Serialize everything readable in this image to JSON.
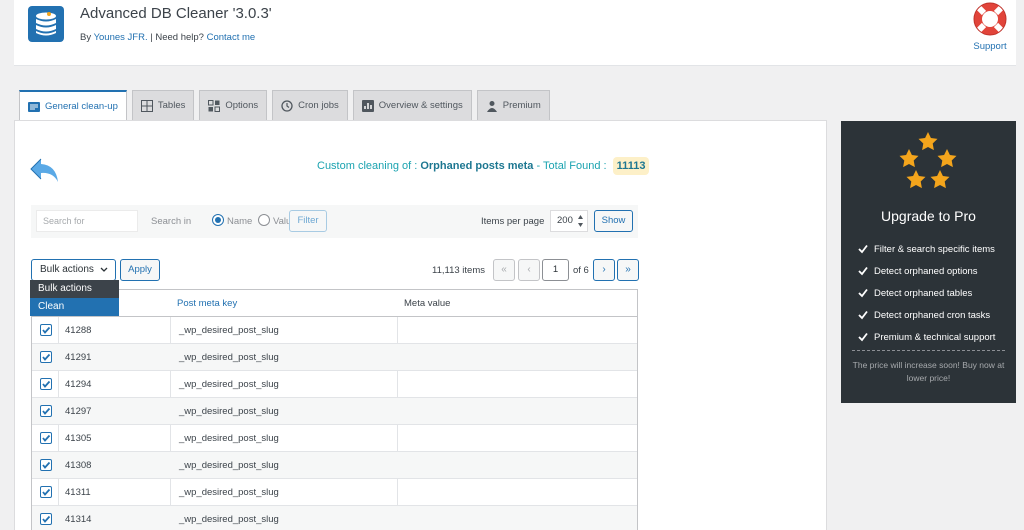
{
  "header": {
    "title": "Advanced DB Cleaner '3.0.3'",
    "by_prefix": "By",
    "author": "Younes JFR.",
    "separator": "|",
    "need_help": "Need help?",
    "contact": "Contact me",
    "support_label": "Support"
  },
  "tabs": [
    {
      "label": "General clean-up",
      "icon": "list-icon",
      "active": true
    },
    {
      "label": "Tables",
      "icon": "grid-icon",
      "active": false
    },
    {
      "label": "Options",
      "icon": "options-icon",
      "active": false
    },
    {
      "label": "Cron jobs",
      "icon": "history-icon",
      "active": false
    },
    {
      "label": "Overview & settings",
      "icon": "chart-icon",
      "active": false
    },
    {
      "label": "Premium",
      "icon": "person-icon",
      "active": false
    }
  ],
  "heading": {
    "prefix": "Custom cleaning of :",
    "target": "Orphaned posts meta",
    "dash": "-",
    "total_label": "Total Found :",
    "total": "11113"
  },
  "filter": {
    "search_placeholder": "Search for",
    "search_in_label": "Search in",
    "option_name": "Name",
    "option_value": "Value",
    "selected": "Name",
    "filter_button": "Filter",
    "items_per_page_label": "Items per page",
    "items_per_page": "200",
    "show_button": "Show"
  },
  "bulk": {
    "selected": "Bulk actions",
    "options": [
      "Bulk actions",
      "Clean"
    ],
    "highlighted": "Clean",
    "apply_button": "Apply"
  },
  "pagination": {
    "items_count": "11,113 items",
    "first": "«",
    "prev": "‹",
    "current_page": "1",
    "of_total": "of 6",
    "next": "›",
    "last": "»"
  },
  "table": {
    "columns": [
      "Post meta key",
      "Meta value"
    ],
    "rows": [
      {
        "id": "41288",
        "key": "_wp_desired_post_slug",
        "value": "",
        "checked": true
      },
      {
        "id": "41291",
        "key": "_wp_desired_post_slug",
        "value": "",
        "checked": true
      },
      {
        "id": "41294",
        "key": "_wp_desired_post_slug",
        "value": "",
        "checked": true
      },
      {
        "id": "41297",
        "key": "_wp_desired_post_slug",
        "value": "",
        "checked": true
      },
      {
        "id": "41305",
        "key": "_wp_desired_post_slug",
        "value": "",
        "checked": true
      },
      {
        "id": "41308",
        "key": "_wp_desired_post_slug",
        "value": "",
        "checked": true
      },
      {
        "id": "41311",
        "key": "_wp_desired_post_slug",
        "value": "",
        "checked": true
      },
      {
        "id": "41314",
        "key": "_wp_desired_post_slug",
        "value": "",
        "checked": true
      }
    ]
  },
  "upgrade": {
    "title": "Upgrade to Pro",
    "features": [
      "Filter & search specific items",
      "Detect orphaned options",
      "Detect orphaned tables",
      "Detect orphaned cron tasks",
      "Premium & technical support"
    ],
    "note": "The price will increase soon! Buy now at lower price!"
  },
  "colors": {
    "accent": "#2271b1",
    "teal": "#1ba3b0",
    "badge_bg": "#fdf0c8",
    "star": "#f4a51c",
    "dark_panel": "#2c3338",
    "support_red": "#e1443a"
  }
}
